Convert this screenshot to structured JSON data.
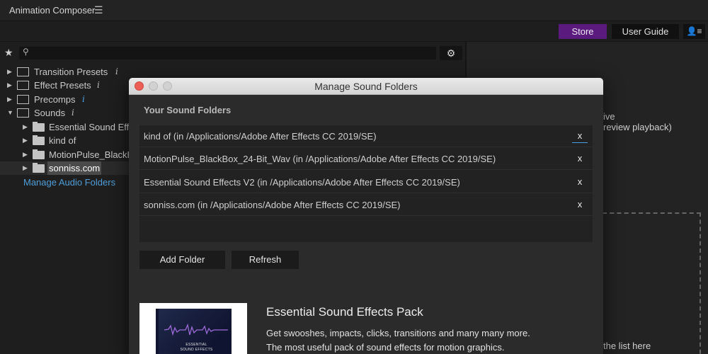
{
  "app": {
    "title": "Animation Composer",
    "menu_icon": "hamburger-icon",
    "menu_glyph": "☰"
  },
  "header": {
    "store_label": "Store",
    "user_guide_label": "User Guide",
    "user_icon": "user-list-icon",
    "user_glyph": "👤≡"
  },
  "toolbar": {
    "favorites_icon": "star-icon",
    "favorites_glyph": "★",
    "search_icon": "search-icon",
    "search_glyph": "⚲",
    "search_value": "",
    "settings_icon": "gear-icon",
    "settings_glyph": "⚙"
  },
  "tree": {
    "items": [
      {
        "label": "Transition Presets",
        "info": "i",
        "icon": "transition-icon"
      },
      {
        "label": "Effect Presets",
        "info": "i",
        "icon": "effect-icon"
      },
      {
        "label": "Precomps",
        "info": "i",
        "icon": "precomp-icon"
      },
      {
        "label": "Sounds",
        "info": "i",
        "icon": "sound-icon",
        "expanded": true
      }
    ],
    "sound_children": [
      {
        "label": "Essential Sound Effe"
      },
      {
        "label": "kind of"
      },
      {
        "label": "MotionPulse_BlackB"
      },
      {
        "label": "sonniss.com",
        "selected": true
      }
    ],
    "expand_glyph": "▶",
    "collapse_glyph": "▼",
    "manage_link": "Manage Audio Folders"
  },
  "right_panel": {
    "text_line1": "ive",
    "text_line2": "review playback)",
    "text_line3": "the list here"
  },
  "modal": {
    "title": "Manage Sound Folders",
    "heading": "Your Sound Folders",
    "folders": [
      {
        "text": "kind of (in /Applications/Adobe After Effects CC 2019/SE)",
        "remove_label": "x"
      },
      {
        "text": "MotionPulse_BlackBox_24-Bit_Wav (in /Applications/Adobe After Effects CC 2019/SE)",
        "remove_label": "x"
      },
      {
        "text": "Essential Sound Effects V2 (in /Applications/Adobe After Effects CC 2019/SE)",
        "remove_label": "x"
      },
      {
        "text": "sonniss.com (in /Applications/Adobe After Effects CC 2019/SE)",
        "remove_label": "x"
      }
    ],
    "add_folder_label": "Add Folder",
    "refresh_label": "Refresh",
    "promo": {
      "image_title_line1": "ESSENTIAL",
      "image_title_line2": "SOUND EFFECTS",
      "title": "Essential Sound Effects Pack",
      "desc_line1": "Get swooshes, impacts, clicks, transitions and many many more.",
      "desc_line2": "The most useful pack of sound effects for motion graphics."
    }
  },
  "colors": {
    "store_accent": "#5b1a7d",
    "link_blue": "#4f9ed9",
    "info_blue": "#4aa3e8",
    "close_red": "#ec5f57"
  }
}
